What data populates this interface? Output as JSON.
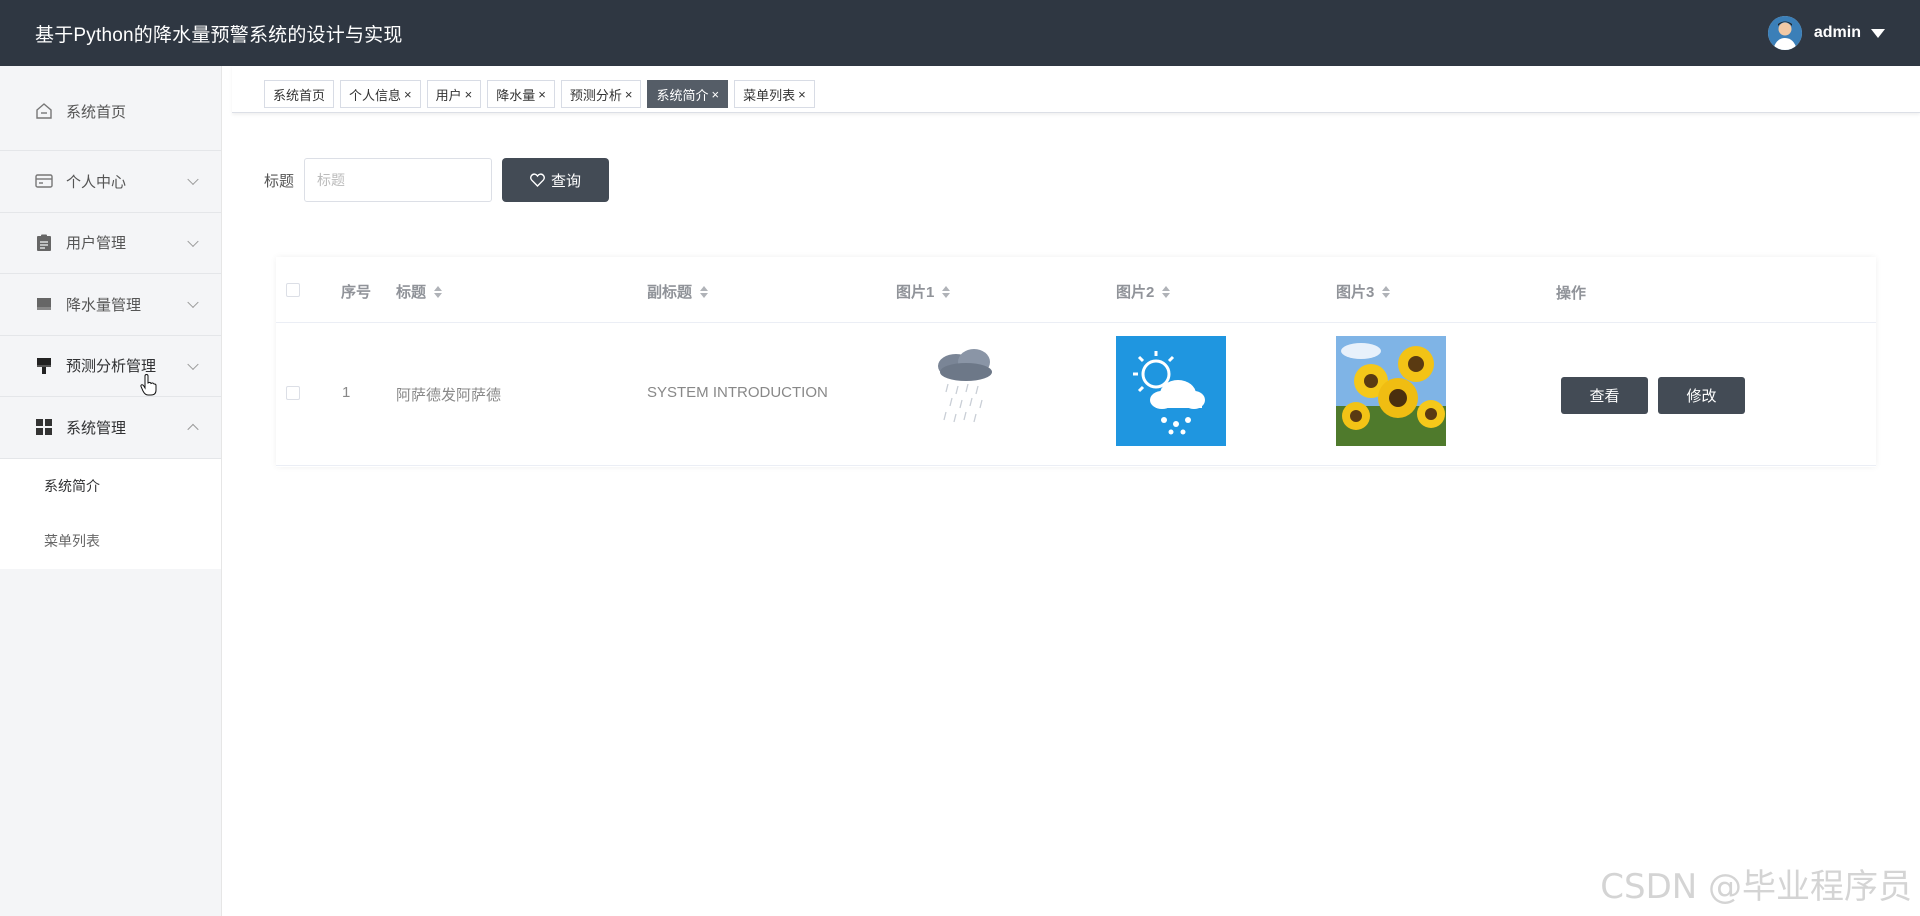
{
  "header": {
    "title": "基于Python的降水量预警系统的设计与实现",
    "username": "admin"
  },
  "sidebar": {
    "items": [
      {
        "label": "系统首页",
        "icon": "home-icon"
      },
      {
        "label": "个人中心",
        "icon": "card-icon"
      },
      {
        "label": "用户管理",
        "icon": "clipboard-icon"
      },
      {
        "label": "降水量管理",
        "icon": "tray-icon"
      },
      {
        "label": "预测分析管理",
        "icon": "brush-icon"
      },
      {
        "label": "系统管理",
        "icon": "grid-icon"
      }
    ],
    "submenu": [
      {
        "label": "系统简介",
        "active": true
      },
      {
        "label": "菜单列表",
        "active": false
      }
    ]
  },
  "tags": [
    {
      "label": "系统首页",
      "closable": false
    },
    {
      "label": "个人信息",
      "closable": true
    },
    {
      "label": "用户",
      "closable": true
    },
    {
      "label": "降水量",
      "closable": true
    },
    {
      "label": "预测分析",
      "closable": true
    },
    {
      "label": "系统简介",
      "closable": true,
      "active": true
    },
    {
      "label": "菜单列表",
      "closable": true
    }
  ],
  "search": {
    "label": "标题",
    "placeholder": "标题",
    "value": "",
    "button_label": "查询"
  },
  "table": {
    "columns": [
      "序号",
      "标题",
      "副标题",
      "图片1",
      "图片2",
      "图片3",
      "操作"
    ],
    "rows": [
      {
        "index": "1",
        "title": "阿萨德发阿萨德",
        "subtitle": "SYSTEM INTRODUCTION",
        "actions": {
          "view": "查看",
          "edit": "修改"
        }
      }
    ]
  },
  "watermark": "CSDN @毕业程序员",
  "colors": {
    "header_bg": "#2f3742",
    "button_bg": "#434b55",
    "active_tag": "#555d67"
  }
}
